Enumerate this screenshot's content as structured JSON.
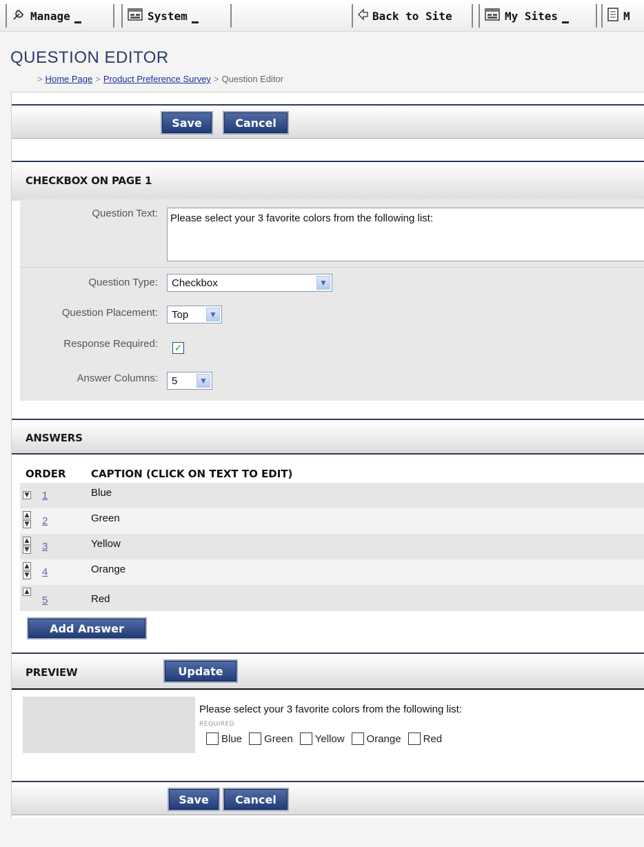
{
  "toolbar": {
    "items": [
      {
        "label": "Manage",
        "icon": "wrench-icon"
      },
      {
        "label": "System",
        "icon": "window-icon"
      },
      {
        "label": "Back to Site",
        "icon": "back-arrow-icon"
      },
      {
        "label": "My Sites",
        "icon": "window-icon"
      },
      {
        "label": "M",
        "icon": "page-icon"
      }
    ]
  },
  "page": {
    "title": "QUESTION EDITOR",
    "breadcrumb": {
      "home": "Home Page",
      "survey": "Product Preference Survey",
      "current": "Question Editor",
      "separator": ">"
    }
  },
  "actions": {
    "save": "Save",
    "cancel": "Cancel"
  },
  "question": {
    "section_title": "CHECKBOX ON PAGE 1",
    "labels": {
      "text": "Question Text:",
      "type": "Question Type:",
      "placement": "Question Placement:",
      "required": "Response Required:",
      "columns": "Answer Columns:"
    },
    "text": "Please select your 3 favorite colors from the following list:",
    "type": "Checkbox",
    "placement": "Top",
    "required": true,
    "columns": "5"
  },
  "answers": {
    "section_title": "ANSWERS",
    "col_order": "ORDER",
    "col_caption": "CAPTION (CLICK ON TEXT TO EDIT)",
    "rows": [
      {
        "order": "1",
        "caption": "Blue"
      },
      {
        "order": "2",
        "caption": "Green"
      },
      {
        "order": "3",
        "caption": "Yellow"
      },
      {
        "order": "4",
        "caption": "Orange"
      },
      {
        "order": "5",
        "caption": "Red"
      }
    ],
    "add_label": "Add Answer"
  },
  "preview": {
    "section_title": "PREVIEW",
    "update_label": "Update",
    "question": "Please select your 3 favorite colors from the following list:",
    "required_note": "REQUIRED",
    "options": [
      "Blue",
      "Green",
      "Yellow",
      "Orange",
      "Red"
    ]
  },
  "colors": {
    "accent": "#2a3c68",
    "button": "#2d4a86",
    "link": "#1f2fa0"
  }
}
